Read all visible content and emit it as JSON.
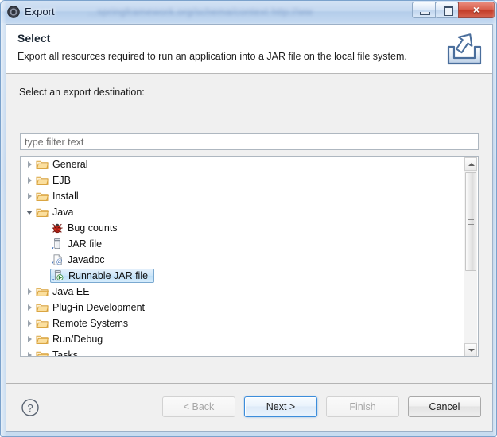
{
  "window": {
    "title": "Export",
    "icon": "export-app-icon",
    "background_blur_text": "...springframework.org/schema/context http://ww",
    "controls": {
      "minimize": "minimize-icon",
      "maximize": "maximize-icon",
      "close": "×"
    }
  },
  "banner": {
    "title": "Select",
    "description": "Export all resources required to run an application into a JAR file on the local file system.",
    "icon": "export-wizard-icon"
  },
  "main": {
    "field_label": "Select an export destination:",
    "filter": {
      "value": "",
      "placeholder": "type filter text"
    },
    "tree": [
      {
        "label": "General",
        "icon": "folder-icon",
        "state": "collapsed",
        "depth": 0,
        "selected": false
      },
      {
        "label": "EJB",
        "icon": "folder-icon",
        "state": "collapsed",
        "depth": 0,
        "selected": false
      },
      {
        "label": "Install",
        "icon": "folder-icon",
        "state": "collapsed",
        "depth": 0,
        "selected": false
      },
      {
        "label": "Java",
        "icon": "folder-icon",
        "state": "expanded",
        "depth": 0,
        "selected": false
      },
      {
        "label": "Bug counts",
        "icon": "bug-icon",
        "state": "leaf",
        "depth": 1,
        "selected": false
      },
      {
        "label": "JAR file",
        "icon": "jar-icon",
        "state": "leaf",
        "depth": 1,
        "selected": false
      },
      {
        "label": "Javadoc",
        "icon": "javadoc-icon",
        "state": "leaf",
        "depth": 1,
        "selected": false
      },
      {
        "label": "Runnable JAR file",
        "icon": "runnable-jar-icon",
        "state": "leaf",
        "depth": 1,
        "selected": true
      },
      {
        "label": "Java EE",
        "icon": "folder-icon",
        "state": "collapsed",
        "depth": 0,
        "selected": false
      },
      {
        "label": "Plug-in Development",
        "icon": "folder-icon",
        "state": "collapsed",
        "depth": 0,
        "selected": false
      },
      {
        "label": "Remote Systems",
        "icon": "folder-icon",
        "state": "collapsed",
        "depth": 0,
        "selected": false
      },
      {
        "label": "Run/Debug",
        "icon": "folder-icon",
        "state": "collapsed",
        "depth": 0,
        "selected": false
      },
      {
        "label": "Tasks",
        "icon": "folder-icon",
        "state": "collapsed",
        "depth": 0,
        "selected": false
      }
    ],
    "scrollbar": {
      "up_arrow": "scroll-up-icon",
      "down_arrow": "scroll-down-icon",
      "thumb_top_pct": 0,
      "thumb_height_pct": 57
    }
  },
  "footer": {
    "help": "?",
    "buttons": [
      {
        "label": "< Back",
        "name": "back-button",
        "enabled": false,
        "default": false
      },
      {
        "label": "Next >",
        "name": "next-button",
        "enabled": true,
        "default": true
      },
      {
        "label": "Finish",
        "name": "finish-button",
        "enabled": false,
        "default": false
      },
      {
        "label": "Cancel",
        "name": "cancel-button",
        "enabled": true,
        "default": false
      }
    ]
  },
  "colors": {
    "accent": "#3c8ddb",
    "selection_border": "#7aa9d0",
    "folder": "#f5c96a",
    "close_button": "#c33c28"
  }
}
